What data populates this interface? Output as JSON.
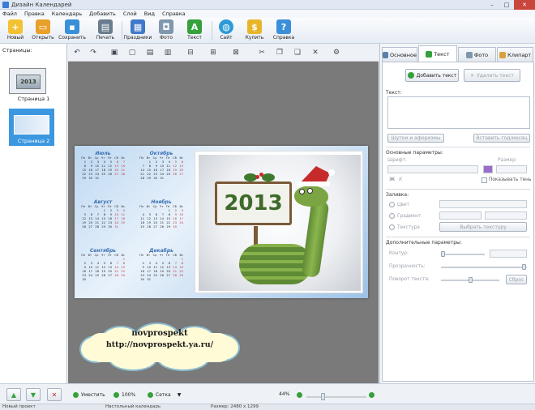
{
  "window": {
    "title": "Дизайн Календарей",
    "controls": [
      "–",
      "□",
      "✕"
    ]
  },
  "menu": [
    "Файл",
    "Правка",
    "Календарь",
    "Добавить",
    "Слой",
    "Вид",
    "Справка"
  ],
  "toolbar": {
    "items": [
      {
        "label": "Новый",
        "icon": "new-doc-icon",
        "color": "#f2c232"
      },
      {
        "label": "Открыть",
        "icon": "open-folder-icon",
        "color": "#e8a02a"
      },
      {
        "label": "Сохранить",
        "icon": "save-icon",
        "color": "#3a8fd8"
      },
      {
        "label": "Печать",
        "icon": "print-icon",
        "color": "#6a7d8f"
      },
      {
        "label": "Праздники",
        "icon": "holidays-icon",
        "color": "#3f79c9"
      },
      {
        "label": "Фото",
        "icon": "photo-icon",
        "color": "#7f98ad"
      },
      {
        "label": "Текст",
        "icon": "text-icon",
        "color": "#35a13c"
      },
      {
        "label": "Сайт",
        "icon": "globe-icon",
        "color": "#2e9ad8"
      },
      {
        "label": "Купить",
        "icon": "buy-icon",
        "color": "#e8b52a"
      },
      {
        "label": "Справка",
        "icon": "help-icon",
        "color": "#3a8fd8"
      }
    ]
  },
  "pages_panel": {
    "title": "Страницы:",
    "pages": [
      {
        "label": "Страница 1",
        "thumb_text": "2013"
      },
      {
        "label": "Страница 2"
      }
    ],
    "selected_index": 1
  },
  "calendar": {
    "weekdays": [
      "Пн",
      "Вт",
      "Ср",
      "Чт",
      "Пт",
      "Сб",
      "Вс"
    ],
    "left_months": [
      "Июль",
      "Август",
      "Сентябрь"
    ],
    "right_months": [
      "Октябрь",
      "Ноябрь",
      "Декабрь"
    ],
    "sign_text": "2013"
  },
  "watermark": {
    "line1": "novprospekt",
    "line2": "http://novprospekt.ya.ru/"
  },
  "right_panel": {
    "tabs": [
      {
        "label": "Основное",
        "icon": "main-icon",
        "color": "#5a7fa8"
      },
      {
        "label": "Текст",
        "icon": "text-icon",
        "color": "#35a13c"
      },
      {
        "label": "Фото",
        "icon": "photo-icon",
        "color": "#7f98ad"
      },
      {
        "label": "Клипарт",
        "icon": "clipart-icon",
        "color": "#d8a23a"
      }
    ],
    "active_tab": 1,
    "add_text_button": "Добавить текст",
    "delete_text_button": "Удалить текст",
    "text_label": "Текст:",
    "jokes_button": "Шутки и афоризмы",
    "insert_holiday_button": "Вставить год/месяц",
    "main_params_label": "Основные параметры:",
    "font_label": "Шрифт:",
    "size_label": "Размер:",
    "shadow_label": "Показывать тень",
    "fill_label": "Заливка:",
    "fill_options": [
      "Цвет",
      "Градиент",
      "Текстура"
    ],
    "choose_texture_button": "Выбрать текстуру",
    "extra_params_label": "Дополнительные параметры:",
    "contour_label": "Контур:",
    "transparency_label": "Прозрачность:",
    "rotation_label": "Поворот текста:",
    "reset_button": "Сброс"
  },
  "statusbar": {
    "fit_label": "Уместить",
    "zoom100_label": "100%",
    "grid_label": "Сетка",
    "zoom_value": "44%",
    "project_text": "Новый проект",
    "calendar_text": "Настольный календарь",
    "size_text": "Размер: 2480 x 1299"
  },
  "colors": {
    "accent": "#3b97e0",
    "green": "#35a13c"
  }
}
